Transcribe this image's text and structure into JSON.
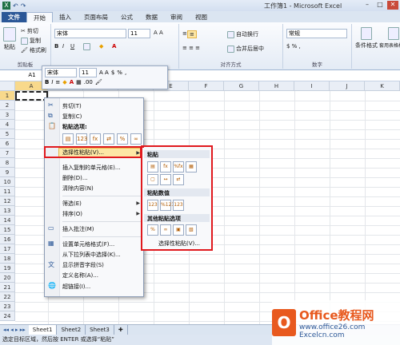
{
  "window": {
    "title": "工作簿1 - Microsoft Excel",
    "qat": [
      "✕",
      "↶",
      "↷"
    ],
    "winbtns": [
      "–",
      "□",
      "✕"
    ]
  },
  "tabs": [
    "文件",
    "开始",
    "插入",
    "页面布局",
    "公式",
    "数据",
    "审阅",
    "视图"
  ],
  "ribbon": {
    "paste": "粘贴",
    "cut": "剪切",
    "copy": "复制",
    "format_painter": "格式刷",
    "clipboard_label": "剪贴板",
    "font_name": "宋体",
    "font_size": "11",
    "wrap": "自动换行",
    "merge": "合并后居中",
    "align_label": "对齐方式",
    "number_format": "常规",
    "number_label": "数字",
    "cond_format": "条件格式",
    "table": "套用表格格式"
  },
  "namebox": "A1",
  "minitoolbar": {
    "font": "宋体",
    "size": "11",
    "pct": "%",
    "comma": ","
  },
  "grid": {
    "columns": [
      "A",
      "B",
      "C",
      "D",
      "E",
      "F",
      "G",
      "H",
      "I",
      "J",
      "K"
    ],
    "rows": [
      "1",
      "2",
      "3",
      "4",
      "5",
      "6",
      "7",
      "8",
      "9",
      "10",
      "11",
      "12",
      "13",
      "14",
      "15",
      "16",
      "17",
      "18",
      "19",
      "20",
      "21",
      "22",
      "23",
      "24"
    ]
  },
  "contextmenu": {
    "items": [
      "剪切(T)",
      "复制(C)",
      "粘贴选项:",
      "选择性粘贴(V)...",
      "插入复制的单元格(E)...",
      "删除(D)...",
      "清除内容(N)",
      "筛选(E)",
      "排序(O)",
      "插入批注(M)",
      "设置单元格格式(F)...",
      "从下拉列表中选择(K)...",
      "显示拼音字段(S)",
      "定义名称(A)...",
      "超链接(I)..."
    ]
  },
  "submenu": {
    "paste": "粘贴",
    "paste_values": "粘贴数值",
    "other": "其他粘贴选项",
    "special": "选择性粘贴(V)..."
  },
  "sheets": [
    "Sheet1",
    "Sheet2",
    "Sheet3"
  ],
  "status": "选定目标区域，然后按 ENTER 或选择“粘贴”",
  "logo": {
    "brand": "Office教程网",
    "url": "www.office26.com",
    "site": "Excelcn.com"
  }
}
